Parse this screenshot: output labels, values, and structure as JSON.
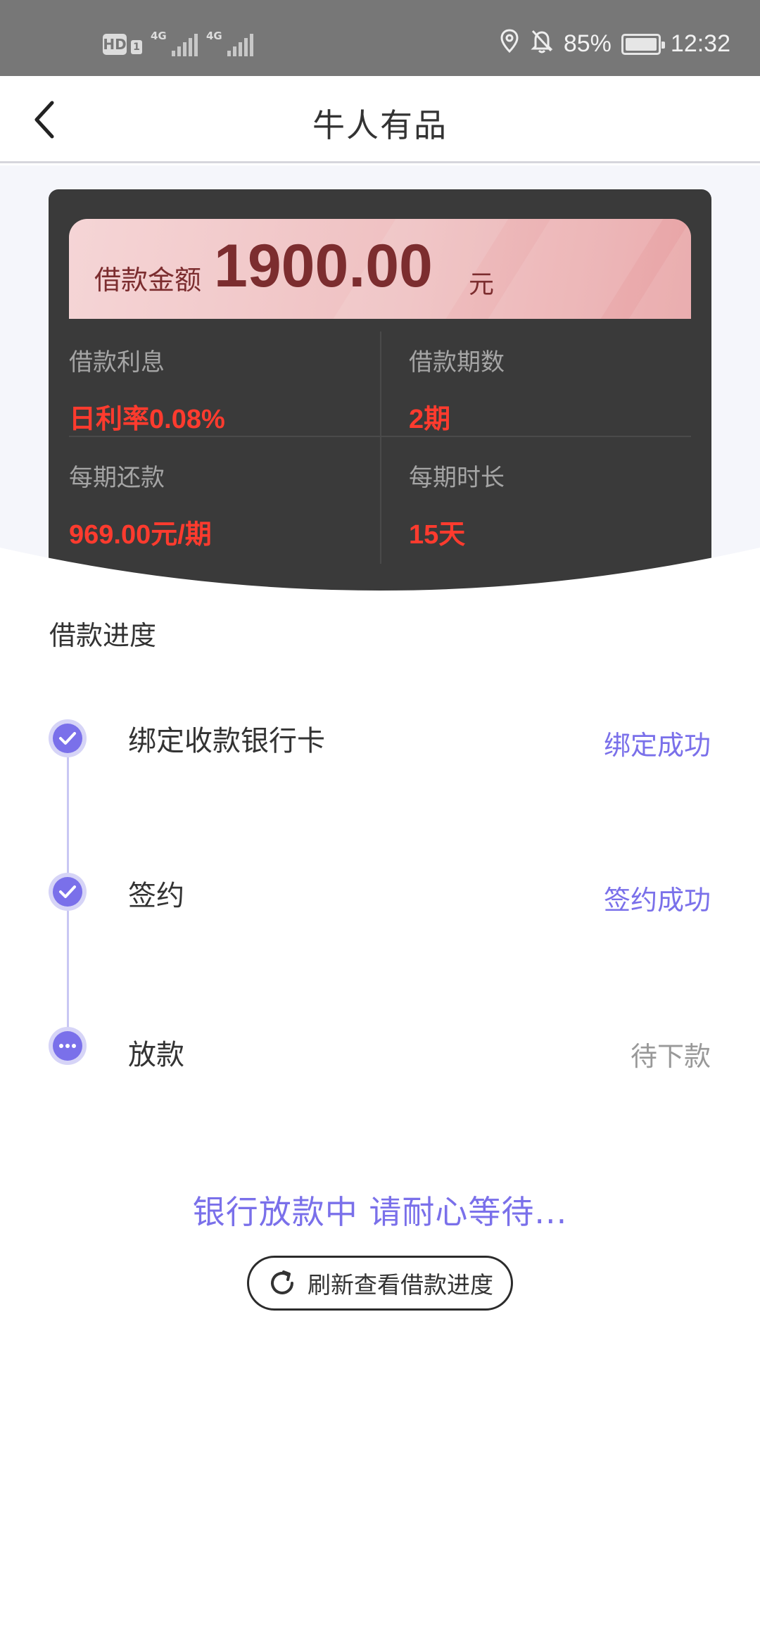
{
  "status_bar": {
    "hd": "HD",
    "sim1": "1",
    "net1": "4G",
    "net2": "4G",
    "battery_pct": "85%",
    "time": "12:32",
    "icons": [
      "location-icon",
      "mute-bell-icon",
      "battery-icon"
    ]
  },
  "nav": {
    "title": "牛人有品",
    "back_icon": "chevron-left-icon"
  },
  "loan": {
    "amount_label": "借款金额",
    "amount": "1900.00",
    "amount_unit": "元",
    "interest_label": "借款利息",
    "interest_value": "日利率0.08%",
    "periods_label": "借款期数",
    "periods_value": "2期",
    "repay_label": "每期还款",
    "repay_value": "969.00元/期",
    "duration_label": "每期时长",
    "duration_value": "15天"
  },
  "progress": {
    "title": "借款进度",
    "steps": [
      {
        "title": "绑定收款银行卡",
        "status": "绑定成功",
        "state": "done",
        "icon": "check-icon"
      },
      {
        "title": "签约",
        "status": "签约成功",
        "state": "done",
        "icon": "check-icon"
      },
      {
        "title": "放款",
        "status": "待下款",
        "state": "pending",
        "icon": "more-dots-icon"
      }
    ]
  },
  "wait_message": "银行放款中 请耐心等待...",
  "refresh_button": {
    "label": "刷新查看借款进度",
    "icon": "refresh-icon"
  },
  "colors": {
    "accent": "#7a70ea",
    "highlight_red": "#ff3b2e",
    "card_dark": "#3a3a3a",
    "banner_pink": "#efc0c1"
  }
}
